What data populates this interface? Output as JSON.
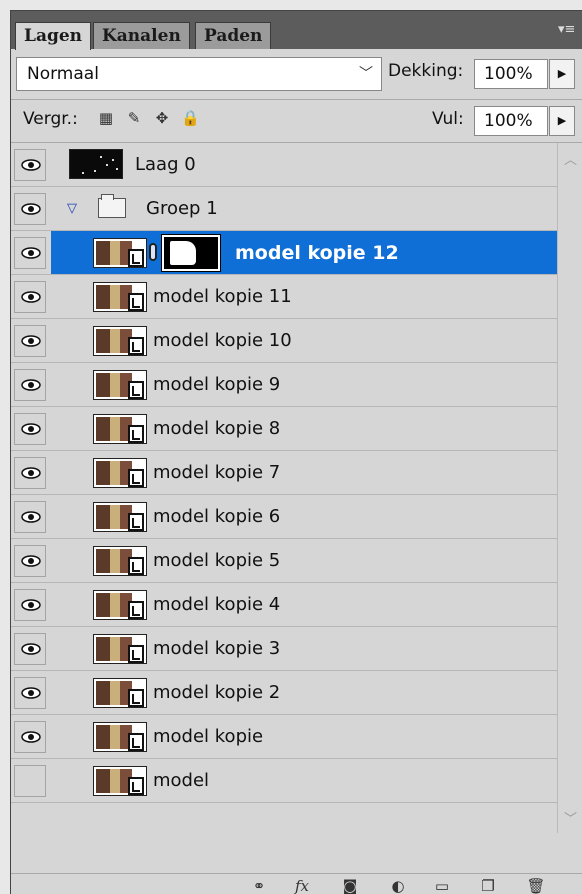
{
  "tabs": [
    {
      "label": "Lagen",
      "active": true
    },
    {
      "label": "Kanalen",
      "active": false
    },
    {
      "label": "Paden",
      "active": false
    }
  ],
  "controls": {
    "blend_mode": "Normaal",
    "opacity_label": "Dekking:",
    "opacity_value": "100%",
    "lock_label": "Vergr.:",
    "fill_label": "Vul:",
    "fill_value": "100%"
  },
  "layers": [
    {
      "name": "Laag 0",
      "kind": "pixel",
      "visible": true
    },
    {
      "name": "Groep 1",
      "kind": "group",
      "visible": true,
      "expanded": true
    },
    {
      "name": "model kopie 12",
      "kind": "smart-masked",
      "visible": true,
      "selected": true
    },
    {
      "name": "model kopie 11",
      "kind": "smart",
      "visible": true
    },
    {
      "name": "model kopie 10",
      "kind": "smart",
      "visible": true
    },
    {
      "name": "model kopie 9",
      "kind": "smart",
      "visible": true
    },
    {
      "name": "model kopie 8",
      "kind": "smart",
      "visible": true
    },
    {
      "name": "model kopie 7",
      "kind": "smart",
      "visible": true
    },
    {
      "name": "model kopie 6",
      "kind": "smart",
      "visible": true
    },
    {
      "name": "model kopie 5",
      "kind": "smart",
      "visible": true
    },
    {
      "name": "model kopie 4",
      "kind": "smart",
      "visible": true
    },
    {
      "name": "model kopie 3",
      "kind": "smart",
      "visible": true
    },
    {
      "name": "model kopie 2",
      "kind": "smart",
      "visible": true
    },
    {
      "name": "model kopie",
      "kind": "smart",
      "visible": true
    },
    {
      "name": "model",
      "kind": "smart",
      "visible": false
    }
  ],
  "icons": {
    "panel_menu": "panel-menu-icon",
    "lock": [
      "lock-transparent-icon",
      "lock-paint-icon",
      "lock-move-icon",
      "lock-all-icon"
    ],
    "toolbar": [
      "link-layers-icon",
      "fx-icon",
      "add-mask-icon",
      "adjustment-layer-icon",
      "new-group-icon",
      "new-layer-icon",
      "delete-layer-icon"
    ]
  },
  "colors": {
    "selection": "#0f6fd7",
    "panel_bg": "#d6d6d6",
    "topbar_bg": "#5c5c5c"
  }
}
